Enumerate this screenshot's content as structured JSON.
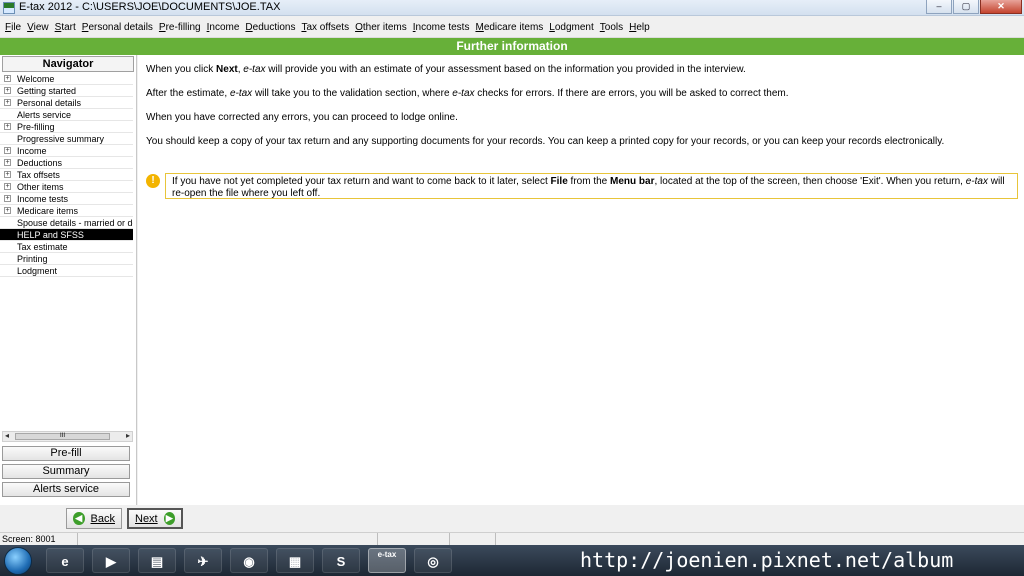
{
  "window": {
    "title": "E-tax 2012 - C:\\USERS\\JOE\\DOCUMENTS\\JOE.TAX",
    "minimize_glyph": "–",
    "maximize_glyph": "▢",
    "close_glyph": "✕"
  },
  "menu": [
    "File",
    "View",
    "Start",
    "Personal details",
    "Pre-filling",
    "Income",
    "Deductions",
    "Tax offsets",
    "Other items",
    "Income tests",
    "Medicare items",
    "Lodgment",
    "Tools",
    "Help"
  ],
  "page_title": "Further information",
  "navigator": {
    "title": "Navigator",
    "items": [
      {
        "label": "Welcome",
        "expandable": true
      },
      {
        "label": "Getting started",
        "expandable": true
      },
      {
        "label": "Personal details",
        "expandable": true
      },
      {
        "label": "Alerts service",
        "expandable": false
      },
      {
        "label": "Pre-filling",
        "expandable": true
      },
      {
        "label": "Progressive summary",
        "expandable": false
      },
      {
        "label": "Income",
        "expandable": true
      },
      {
        "label": "Deductions",
        "expandable": true
      },
      {
        "label": "Tax offsets",
        "expandable": true
      },
      {
        "label": "Other items",
        "expandable": true
      },
      {
        "label": "Income tests",
        "expandable": true
      },
      {
        "label": "Medicare items",
        "expandable": true
      },
      {
        "label": "Spouse details - married or de facto",
        "expandable": false
      },
      {
        "label": "HELP and SFSS",
        "expandable": false,
        "selected": true
      },
      {
        "label": "Tax estimate",
        "expandable": false
      },
      {
        "label": "Printing",
        "expandable": false
      },
      {
        "label": "Lodgment",
        "expandable": false
      }
    ],
    "scroll_thumb_glyph": "III",
    "buttons": {
      "prefill": "Pre-fill",
      "summary": "Summary",
      "alerts": "Alerts service"
    }
  },
  "content": {
    "p1_a": "When you click ",
    "p1_b": "Next",
    "p1_c": ", ",
    "p1_d": "e-tax",
    "p1_e": " will provide you with an estimate of your assessment based on the information you provided in the interview.",
    "p2_a": "After the estimate, ",
    "p2_b": "e-tax",
    "p2_c": " will take you to the validation section, where ",
    "p2_d": "e-tax",
    "p2_e": " checks for errors. If there are errors, you will be asked to correct them.",
    "p3": "When you have corrected any errors, you can proceed to lodge online.",
    "p4": "You should keep a copy of your tax return and any supporting documents for your records. You can keep a printed copy for your records, or you can keep your records electronically.",
    "note_a": "If you have not yet completed your tax return and want to come back to it later, select ",
    "note_b": "File",
    "note_c": " from the ",
    "note_d": "Menu bar",
    "note_e": ", located at the top of the screen, then choose 'Exit'. When you return, ",
    "note_f": "e-tax",
    "note_g": " will re-open the file where you left off.",
    "note_icon": "!"
  },
  "buttons": {
    "back": "Back",
    "next": "Next",
    "back_glyph": "◀",
    "next_glyph": "▶"
  },
  "status": {
    "screen": "Screen: 8001"
  },
  "taskbar": {
    "icons": [
      "internet-explorer",
      "media-player",
      "file-explorer",
      "app",
      "chrome",
      "folder",
      "skype",
      "e-tax",
      "app"
    ],
    "etax_label": "e-tax",
    "skype_label": "S"
  },
  "watermark": "http://joenien.pixnet.net/album"
}
